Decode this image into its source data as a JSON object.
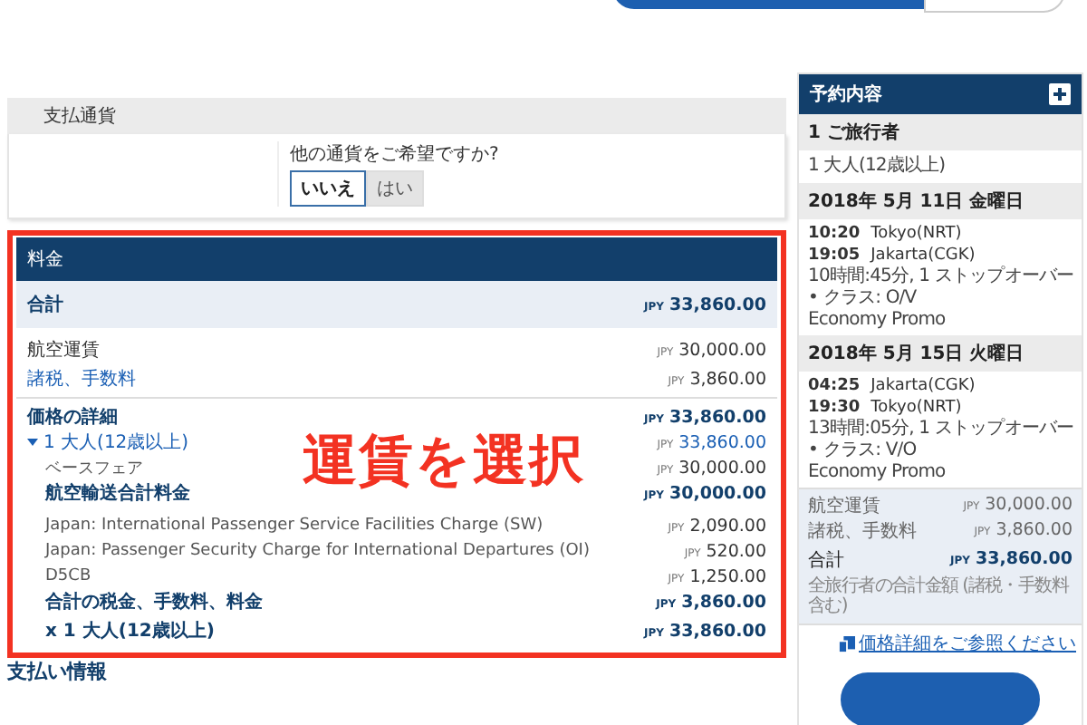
{
  "currency": {
    "title": "支払通貨",
    "question": "他の通貨をご希望ですか?",
    "options": [
      {
        "label": "いいえ",
        "selected": true
      },
      {
        "label": "はい",
        "selected": false
      }
    ]
  },
  "fare": {
    "title": "料金",
    "total": {
      "label": "合計",
      "currency": "JPY",
      "amount": "33,860.00"
    },
    "lines": [
      {
        "label": "航空運賃",
        "kind": "plain",
        "currency": "JPY",
        "amount": "30,000.00"
      },
      {
        "label": "諸税、手数料",
        "kind": "link",
        "currency": "JPY",
        "amount": "3,860.00"
      }
    ],
    "details": {
      "title": "価格の詳細",
      "currency": "JPY",
      "amount": "33,860.00",
      "passenger": {
        "label": "1 大人(12歳以上)",
        "expanded": true,
        "currency": "JPY",
        "amount": "33,860.00"
      },
      "rows": [
        {
          "label": "ベースフェア",
          "kind": "item",
          "currency": "JPY",
          "amount": "30,000.00"
        },
        {
          "label": "航空輸送合計料金",
          "kind": "subtotal",
          "currency": "JPY",
          "amount": "30,000.00"
        },
        {
          "label": "Japan: International Passenger Service Facilities Charge (SW)",
          "kind": "item",
          "currency": "JPY",
          "amount": "2,090.00"
        },
        {
          "label": "Japan: Passenger Security Charge for International Departures (OI)",
          "kind": "item",
          "currency": "JPY",
          "amount": "520.00"
        },
        {
          "label": "D5CB",
          "kind": "item",
          "currency": "JPY",
          "amount": "1,250.00"
        },
        {
          "label": "合計の税金、手数料、料金",
          "kind": "subtotal",
          "currency": "JPY",
          "amount": "3,860.00"
        },
        {
          "label": "x 1 大人(12歳以上)",
          "kind": "subtotal",
          "currency": "JPY",
          "amount": "33,860.00"
        }
      ]
    }
  },
  "annotation": "運賃を選択",
  "payment_title": "支払い情報",
  "summary": {
    "title": "予約内容",
    "travelers": {
      "title": "1 ご旅行者",
      "lines": [
        "1 大人(12歳以上)"
      ]
    },
    "flights": [
      {
        "date": "2018年 5月 11日 金曜日",
        "segments": [
          {
            "time": "10:20",
            "place": "Tokyo(NRT)"
          },
          {
            "time": "19:05",
            "place": "Jakarta(CGK)"
          }
        ],
        "duration": "10時間:45分, 1 ストップオーバー",
        "class": "• クラス: O/V",
        "cabin": "Economy Promo"
      },
      {
        "date": "2018年 5月 15日 火曜日",
        "segments": [
          {
            "time": "04:25",
            "place": "Jakarta(CGK)"
          },
          {
            "time": "19:30",
            "place": "Tokyo(NRT)"
          }
        ],
        "duration": "13時間:05分, 1 ストップオーバー",
        "class": "• クラス: V/O",
        "cabin": "Economy Promo"
      }
    ],
    "prices": [
      {
        "label": "航空運賃",
        "kind": "item",
        "currency": "JPY",
        "amount": "30,000.00"
      },
      {
        "label": "諸税、手数料",
        "kind": "item",
        "currency": "JPY",
        "amount": "3,860.00"
      },
      {
        "label": "合計",
        "kind": "total",
        "currency": "JPY",
        "amount": "33,860.00"
      }
    ],
    "note": "全旅行者の合計金額 (諸税・手数料含む)",
    "link": "価格詳細をご参照ください"
  }
}
